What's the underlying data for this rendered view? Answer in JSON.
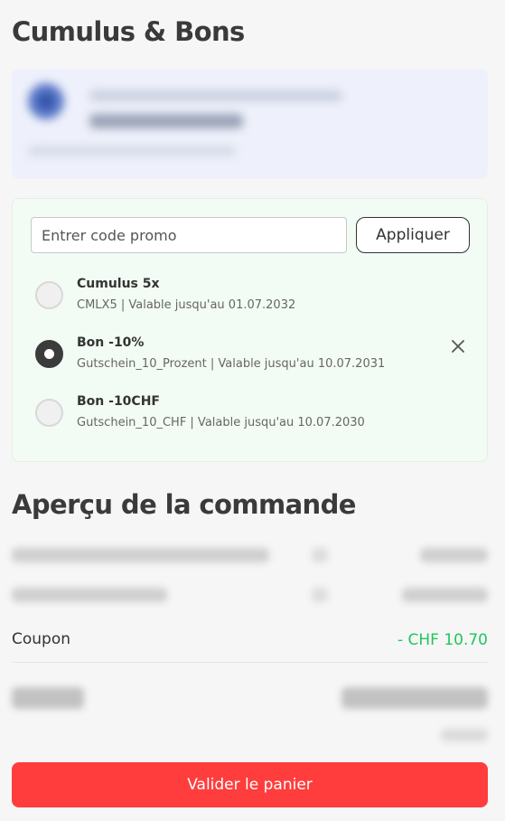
{
  "page": {
    "title": "Cumulus & Bons"
  },
  "promo": {
    "input_placeholder": "Entrer code promo",
    "input_value": "",
    "apply_label": "Appliquer",
    "coupons": [
      {
        "name": "Cumulus 5x",
        "description": "CMLX5 | Valable jusqu'au 01.07.2032",
        "selected": false
      },
      {
        "name": "Bon -10%",
        "description": "Gutschein_10_Prozent | Valable jusqu'au 10.07.2031",
        "selected": true
      },
      {
        "name": "Bon -10CHF",
        "description": "Gutschein_10_CHF | Valable jusqu'au 10.07.2030",
        "selected": false
      }
    ],
    "remove_icon": "close-icon"
  },
  "order": {
    "title": "Aperçu de la commande",
    "coupon_label": "Coupon",
    "coupon_value": "- CHF 10.70",
    "coupon_value_color": "#22c55e"
  },
  "actions": {
    "submit_label": "Valider le panier",
    "submit_color": "#ff3d3d"
  }
}
